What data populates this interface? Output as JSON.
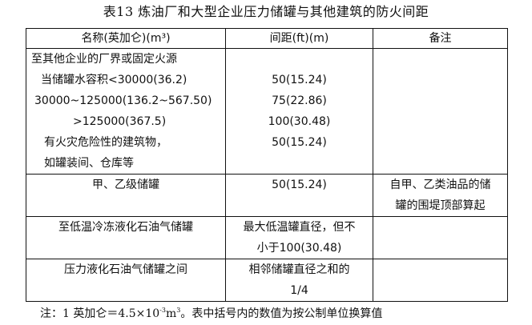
{
  "title": "表13 炼油厂和大型企业压力储罐与其他建筑的防火间距",
  "table": {
    "headers": [
      "名称(英加仑)(m³)",
      "间距(ft)(m)",
      "备注"
    ],
    "row1": {
      "name_lines": [
        "至其他企业的厂界或固定火源",
        "当储罐水容积<30000(36.2)",
        "30000~125000(136.2~567.50)",
        ">125000(367.5)",
        "有火灾危险性的建筑物，",
        "如罐装间、仓库等"
      ],
      "dist_lines": [
        "50(15.24)",
        "75(22.86)",
        "100(30.48)",
        "50(15.24)"
      ],
      "remark": ""
    },
    "row2": {
      "name": "甲、乙级储罐",
      "dist": "50(15.24)",
      "remark_lines": [
        "自甲、乙类油品的储",
        "罐的围堤顶部算起"
      ]
    },
    "row3": {
      "name": "至低温冷冻液化石油气储罐",
      "dist_lines": [
        "最大低温罐直径，但不",
        "小于100(30.48)"
      ],
      "remark": ""
    },
    "row4": {
      "name": "压力液化石油气储罐之间",
      "dist_lines": [
        "相邻储罐直径之和的",
        "1/4"
      ],
      "remark": ""
    }
  },
  "note": {
    "prefix": "注：1 英加仑＝4.5×10",
    "exp1": "-3",
    "mid": "m",
    "exp2": "3",
    "suffix": "。表中括号内的数值为按公制单位换算值"
  }
}
